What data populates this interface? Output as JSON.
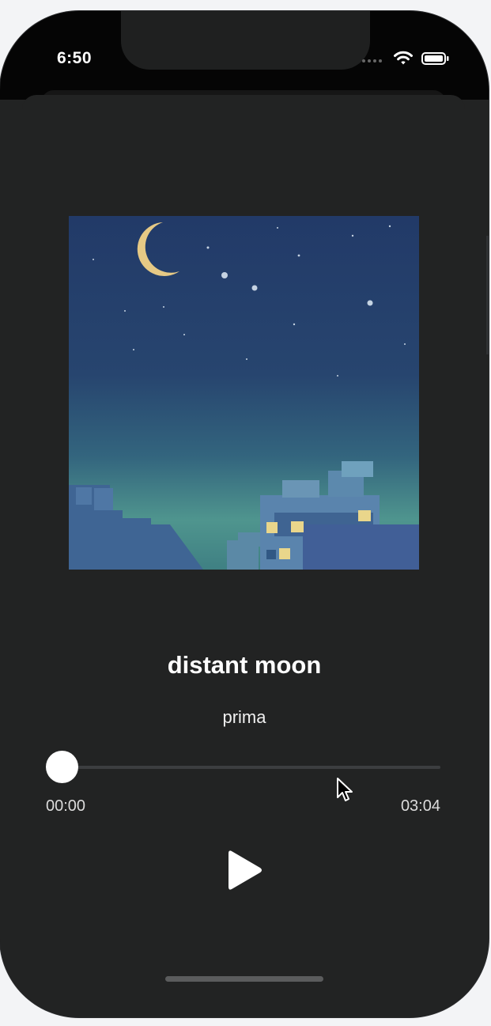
{
  "status_bar": {
    "time": "6:50",
    "icons": [
      "cellular-icon",
      "wifi-icon",
      "battery-icon"
    ]
  },
  "player": {
    "artwork": {
      "description": "",
      "scene": "night-sky-city"
    },
    "song_title": "distant moon",
    "artist": "prima",
    "progress": {
      "value": 0,
      "elapsed": "00:00",
      "total": "03:04"
    },
    "controls": {
      "play": "play-icon"
    }
  },
  "colors": {
    "background": "#222323",
    "accent": "#ffffff",
    "track": "#3c3e40",
    "text_primary": "#ffffff",
    "text_secondary": "#dcdcdc"
  }
}
